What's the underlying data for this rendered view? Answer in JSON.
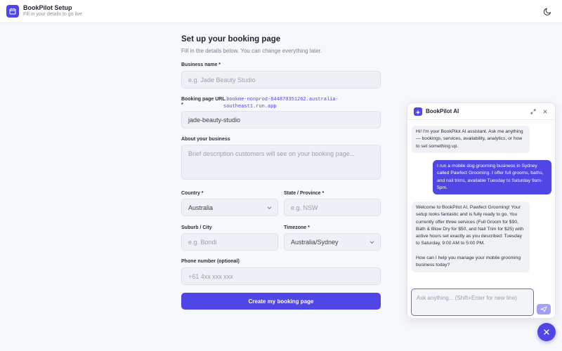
{
  "app": {
    "title": "BookPilot Setup",
    "subtitle": "Fill in your details to go live"
  },
  "form": {
    "title": "Set up your booking page",
    "subtitle": "Fill in the details below. You can change everything later.",
    "business_name": {
      "label": "Business name *",
      "placeholder": "e.g. Jade Beauty Studio"
    },
    "booking_url": {
      "label_line1": "Booking page URL",
      "label_line2": "*",
      "domain": "…bookme-nonprod-844870351262.australia-southeast1.run.app",
      "value": "jade-beauty-studio"
    },
    "about": {
      "label": "About your business",
      "placeholder": "Brief description customers will see on your booking page..."
    },
    "country": {
      "label": "Country *",
      "value": "Australia"
    },
    "state": {
      "label": "State / Province *",
      "placeholder": "e.g. NSW"
    },
    "suburb": {
      "label": "Suburb / City",
      "placeholder": "e.g. Bondi"
    },
    "timezone": {
      "label": "Timezone *",
      "value": "Australia/Sydney"
    },
    "phone": {
      "label": "Phone number (optional)",
      "placeholder": "+61 4xx xxx xxx"
    },
    "submit_label": "Create my booking page"
  },
  "chat": {
    "title": "BookPilot AI",
    "messages": [
      {
        "role": "bot",
        "text": "Hi! I'm your BookPilot AI assistant. Ask me anything — bookings, services, availability, analytics, or how to set something up."
      },
      {
        "role": "user",
        "text": "I run a mobile dog grooming business in Sydney called Pawfect Grooming. I offer full grooms, baths, and nail trims, available Tuesday to Saturday 9am-5pm."
      },
      {
        "role": "bot",
        "text": "Welcome to BookPilot AI, Pawfect Grooming! Your setup looks fantastic and is fully ready to go. You currently offer three services (Full Groom for $90, Bath & Blow Dry for $50, and Nail Trim for $25) with active hours set exactly as you described: Tuesday to Saturday, 9:00 AM to 5:00 PM."
      },
      {
        "role": "bot",
        "text": "How can I help you manage your mobile grooming business today?"
      }
    ],
    "input_placeholder": "Ask anything... (Shift+Enter for new line)"
  },
  "colors": {
    "accent": "#4f46e5"
  }
}
